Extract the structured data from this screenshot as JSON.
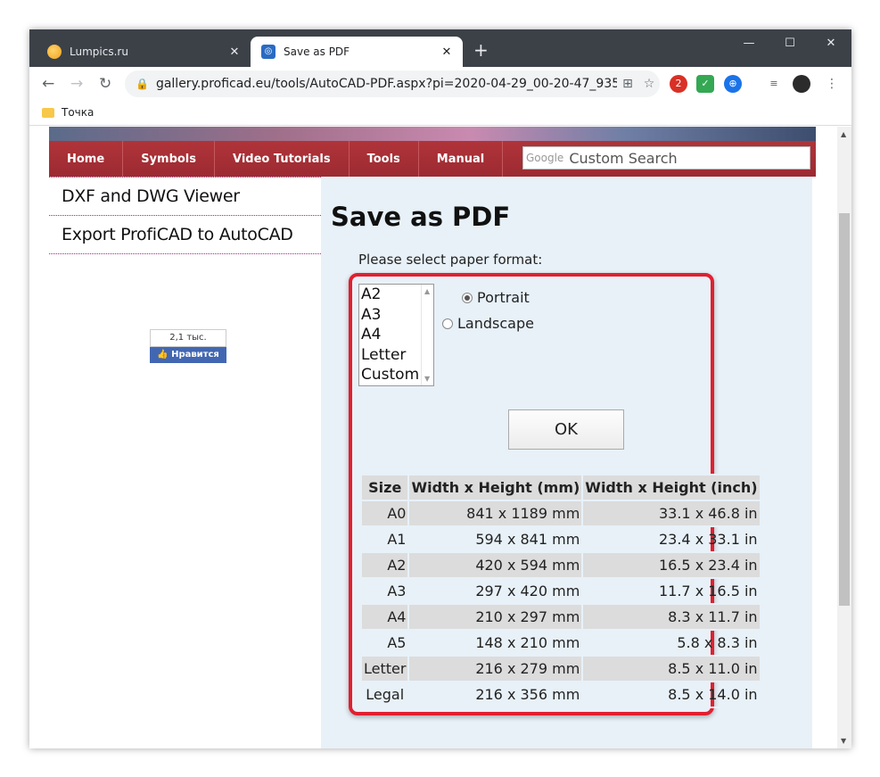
{
  "browser": {
    "tabs": [
      {
        "title": "Lumpics.ru",
        "close": "✕"
      },
      {
        "title": "Save as PDF",
        "close": "✕"
      }
    ],
    "new_tab": "+",
    "window_controls": {
      "minimize": "—",
      "maximize": "☐",
      "close": "✕"
    },
    "url": "gallery.proficad.eu/tools/AutoCAD-PDF.aspx?pi=2020-04-29_00-20-47_9352...",
    "bookmark": "Точка",
    "extension_badge": "2"
  },
  "site": {
    "nav": [
      "Home",
      "Symbols",
      "Video Tutorials",
      "Tools",
      "Manual"
    ],
    "search_brand": "Google",
    "search_placeholder": "Custom Search",
    "sidebar_links": [
      "DXF and DWG Viewer",
      "Export ProfiCAD to AutoCAD"
    ],
    "fb_count": "2,1 тыс.",
    "fb_like": "Нравится"
  },
  "main": {
    "title": "Save as PDF",
    "select_label": "Please select paper format:",
    "formats": [
      "A2",
      "A3",
      "A4",
      "Letter",
      "Custom"
    ],
    "orientation": [
      "Portrait",
      "Landscape"
    ],
    "selected_orientation": "Portrait",
    "ok_label": "OK",
    "table_headers": [
      "Size",
      "Width x Height (mm)",
      "Width x Height (inch)"
    ],
    "table_rows": [
      [
        "A0",
        "841 x 1189 mm",
        "33.1 x 46.8 in"
      ],
      [
        "A1",
        "594 x 841 mm",
        "23.4 x 33.1 in"
      ],
      [
        "A2",
        "420 x 594 mm",
        "16.5 x 23.4 in"
      ],
      [
        "A3",
        "297 x 420 mm",
        "11.7 x 16.5 in"
      ],
      [
        "A4",
        "210 x 297 mm",
        "8.3 x 11.7 in"
      ],
      [
        "A5",
        "148 x 210 mm",
        "5.8 x 8.3 in"
      ],
      [
        "Letter",
        "216 x 279 mm",
        "8.5 x 11.0 in"
      ],
      [
        "Legal",
        "216 x 356 mm",
        "8.5 x 14.0 in"
      ]
    ]
  },
  "colors": {
    "nav_bg": "#9c2a31",
    "highlight_frame": "#e02030",
    "content_bg": "#e8f1f8"
  }
}
